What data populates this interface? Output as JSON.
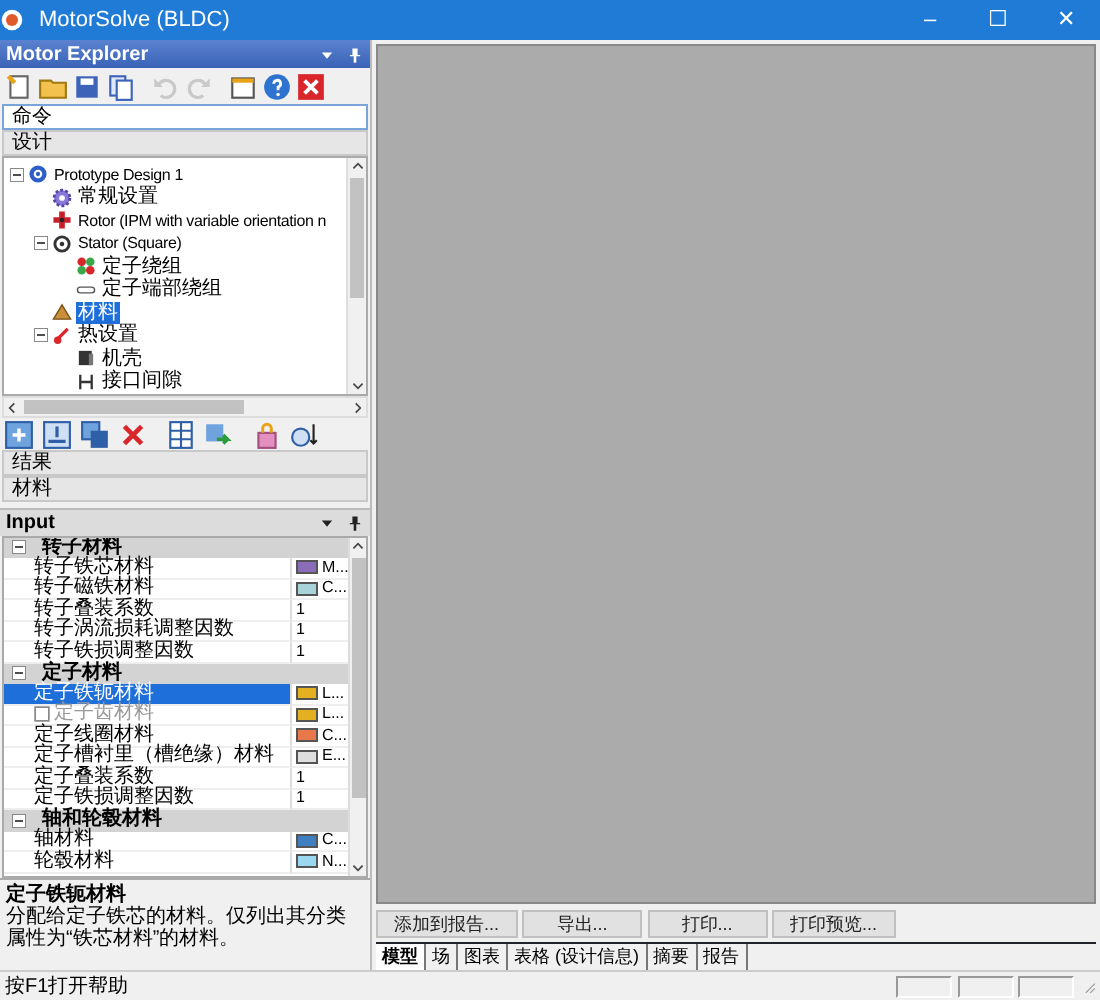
{
  "window": {
    "title": "MotorSolve (BLDC)",
    "controls": [
      "–",
      "☐",
      "✕"
    ]
  },
  "explorer": {
    "title": "Motor Explorer",
    "toolbar": [
      {
        "kind": "new",
        "disabled": false
      },
      {
        "kind": "open",
        "disabled": false
      },
      {
        "kind": "save",
        "disabled": false
      },
      {
        "kind": "saveas",
        "disabled": false
      },
      {
        "kind": "undo",
        "disabled": true
      },
      {
        "kind": "redo",
        "disabled": true
      },
      {
        "kind": "window",
        "disabled": false
      },
      {
        "kind": "help",
        "disabled": false
      },
      {
        "kind": "close",
        "disabled": false
      }
    ],
    "sections_top": [
      {
        "label": "命令",
        "selected": true
      },
      {
        "label": "设计",
        "selected": false
      }
    ],
    "tree": [
      {
        "label": "Prototype Design 1",
        "kind": "design",
        "expanded": true,
        "selected": false,
        "children": [
          {
            "label": "常规设置",
            "kind": "settings",
            "selected": false
          },
          {
            "label": "Rotor (IPM with variable orientation n",
            "kind": "rotor",
            "selected": false
          },
          {
            "label": "Stator (Square)",
            "kind": "stator",
            "expanded": true,
            "selected": false,
            "children": [
              {
                "label": "定子绕组",
                "kind": "winding",
                "selected": false
              },
              {
                "label": "定子端部绕组",
                "kind": "endwinding",
                "selected": false
              }
            ]
          },
          {
            "label": "材料",
            "kind": "material",
            "selected": true
          },
          {
            "label": "热设置",
            "kind": "thermal",
            "expanded": true,
            "selected": false,
            "children": [
              {
                "label": "机壳",
                "kind": "housing",
                "selected": false
              },
              {
                "label": "接口间隙",
                "kind": "gap",
                "selected": false
              }
            ]
          }
        ]
      }
    ],
    "tree_toolbar": [
      {
        "kind": "add"
      },
      {
        "kind": "import"
      },
      {
        "kind": "copy"
      },
      {
        "kind": "delete"
      },
      {
        "kind": "grid"
      },
      {
        "kind": "arrows"
      },
      {
        "kind": "lock"
      },
      {
        "kind": "sort"
      }
    ],
    "sections_bottom": [
      {
        "label": "结果",
        "selected": false
      },
      {
        "label": "材料",
        "selected": false
      }
    ]
  },
  "input": {
    "title": "Input",
    "categories": [
      {
        "label": "转子材料",
        "expanded": true,
        "rows": [
          {
            "name": "转子铁芯材料",
            "value": "M...",
            "kind": "swatch",
            "color": "#8a6cb8",
            "selected": false,
            "disabled": false
          },
          {
            "name": "转子磁铁材料",
            "value": "C...",
            "kind": "swatch",
            "color": "#a8d4d9",
            "selected": false,
            "disabled": false
          },
          {
            "name": "转子叠装系数",
            "value": "1",
            "kind": "text",
            "selected": false,
            "disabled": false
          },
          {
            "name": "转子涡流损耗调整因数",
            "value": "1",
            "kind": "text",
            "selected": false,
            "disabled": false
          },
          {
            "name": "转子铁损调整因数",
            "value": "1",
            "kind": "text",
            "selected": false,
            "disabled": false
          }
        ]
      },
      {
        "label": "定子材料",
        "expanded": true,
        "rows": [
          {
            "name": "定子铁轭材料",
            "value": "L...",
            "kind": "swatch",
            "color": "#e2b021",
            "selected": true,
            "disabled": false
          },
          {
            "name": "定子齿材料",
            "value": "L...",
            "kind": "check-swatch",
            "checked": false,
            "color": "#e2b021",
            "selected": false,
            "disabled": true
          },
          {
            "name": "定子线圈材料",
            "value": "C...",
            "kind": "swatch",
            "color": "#e8774a",
            "selected": false,
            "disabled": false
          },
          {
            "name": "定子槽衬里（槽绝缘）材料",
            "value": "E...",
            "kind": "swatch",
            "color": "#dedede",
            "selected": false,
            "disabled": false
          },
          {
            "name": "定子叠装系数",
            "value": "1",
            "kind": "text",
            "selected": false,
            "disabled": false
          },
          {
            "name": "定子铁损调整因数",
            "value": "1",
            "kind": "text",
            "selected": false,
            "disabled": false
          }
        ]
      },
      {
        "label": "轴和轮毂材料",
        "expanded": true,
        "rows": [
          {
            "name": "轴材料",
            "value": "C...",
            "kind": "swatch",
            "color": "#3d7fc1",
            "selected": false,
            "disabled": false
          },
          {
            "name": "轮毂材料",
            "value": "N...",
            "kind": "swatch",
            "color": "#9ad7f0",
            "selected": false,
            "disabled": false
          }
        ]
      }
    ],
    "description": {
      "title": "定子铁轭材料",
      "text": "分配给定子铁芯的材料。仅列出其分类属性为“铁芯材料”的材料。"
    }
  },
  "main": {
    "buttons": [
      "添加到报告...",
      "导出...",
      "打印...",
      "打印预览..."
    ],
    "tabs": [
      {
        "label": "模型",
        "selected": true
      },
      {
        "label": "场",
        "selected": false
      },
      {
        "label": "图表",
        "selected": false
      },
      {
        "label": "表格 (设计信息)",
        "selected": false
      },
      {
        "label": "摘要",
        "selected": false
      },
      {
        "label": "报告",
        "selected": false
      }
    ]
  },
  "status_bar": {
    "text": "按F1打开帮助"
  }
}
